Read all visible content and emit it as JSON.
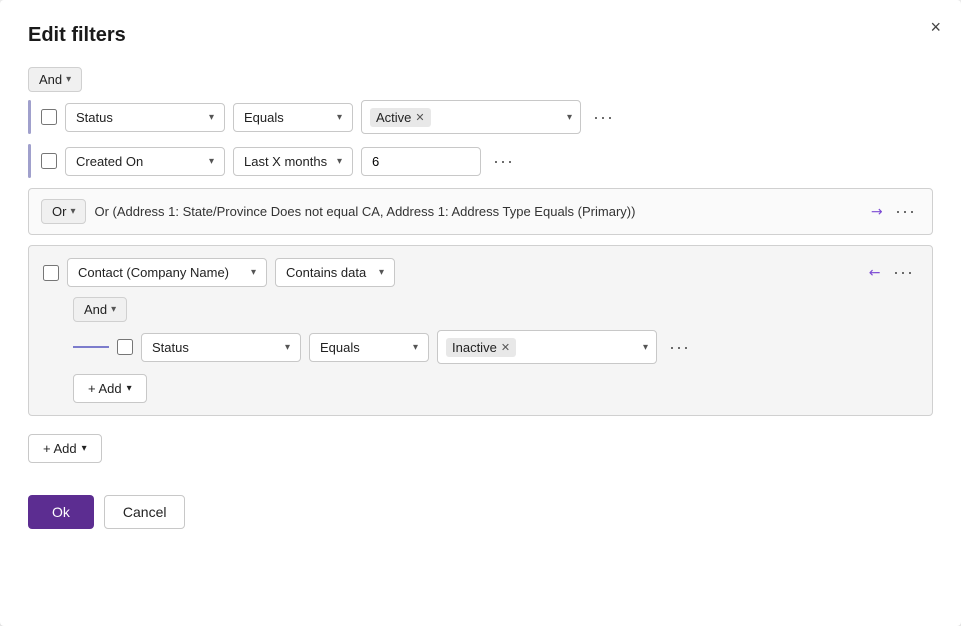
{
  "dialog": {
    "title": "Edit filters",
    "close_label": "×"
  },
  "top_logic": {
    "label": "And",
    "chevron": "▾"
  },
  "rows": [
    {
      "id": "row1",
      "field": "Status",
      "operator": "Equals",
      "value_tag": "Active",
      "type": "tag"
    },
    {
      "id": "row2",
      "field": "Created On",
      "operator": "Last X months",
      "value_text": "6",
      "type": "text"
    }
  ],
  "or_group": {
    "logic_label": "Or",
    "chevron": "▾",
    "description": "Or (Address 1: State/Province Does not equal CA, Address 1: Address Type Equals (Primary))",
    "expand_icon": "↗"
  },
  "nested_group": {
    "field": "Contact (Company Name)",
    "operator": "Contains data",
    "shrink_icon": "↙",
    "and_logic": "And",
    "and_chevron": "▾",
    "inner_row": {
      "field": "Status",
      "operator": "Equals",
      "value_tag": "Inactive"
    },
    "add_label": "+ Add",
    "add_chevron": "▾"
  },
  "bottom_add": {
    "label": "+ Add",
    "chevron": "▾"
  },
  "footer": {
    "ok_label": "Ok",
    "cancel_label": "Cancel"
  }
}
